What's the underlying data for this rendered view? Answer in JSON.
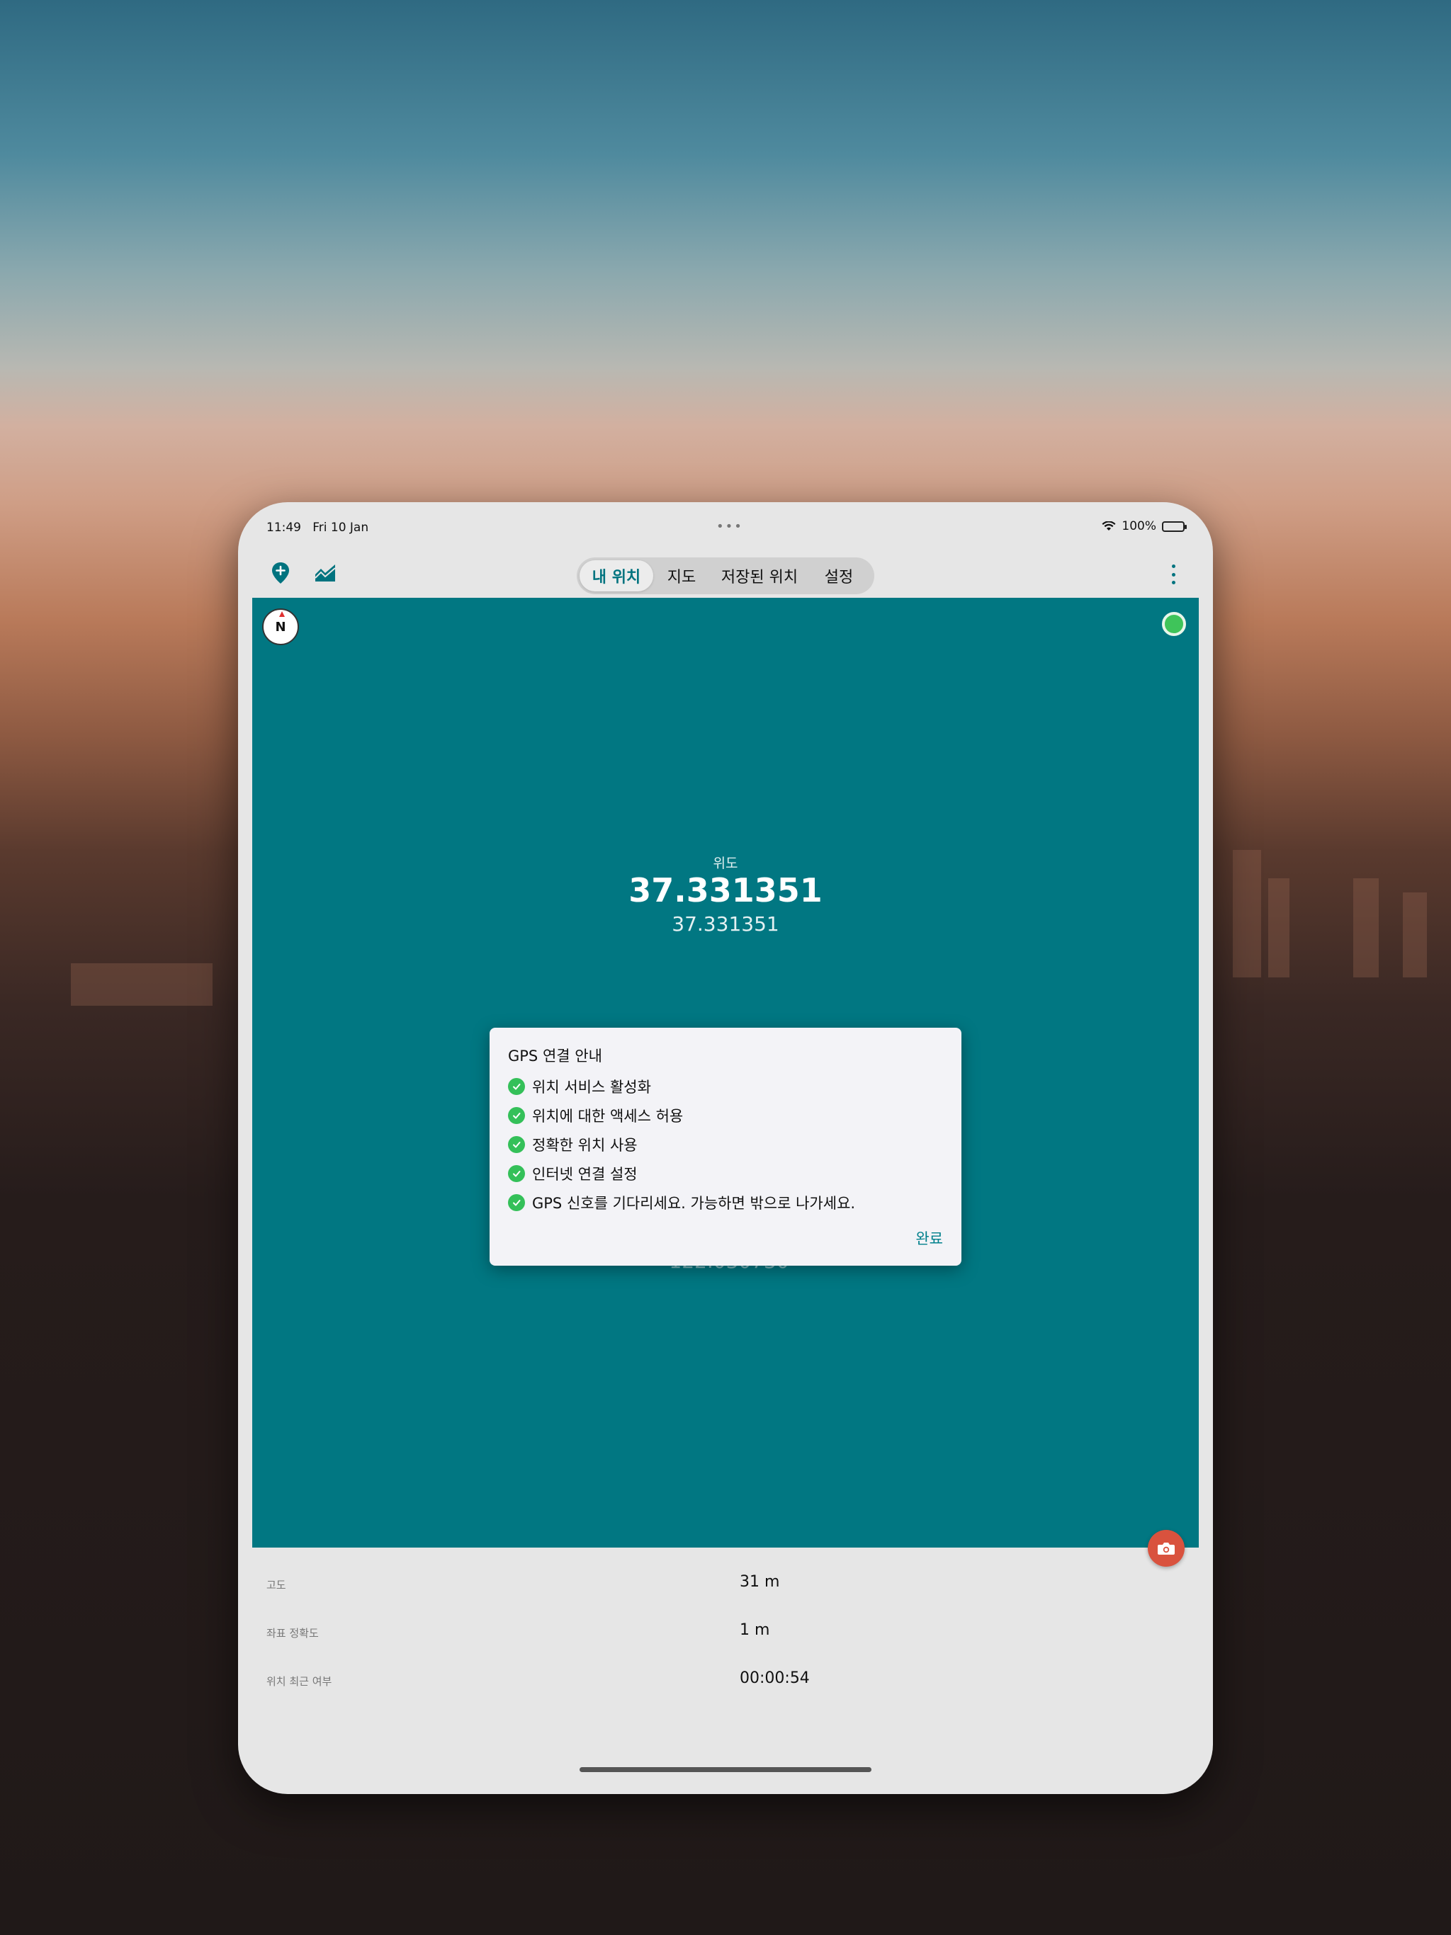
{
  "status_bar": {
    "time": "11:49",
    "date": "Fri 10 Jan",
    "dots": "•••",
    "battery": "100%"
  },
  "toolbar": {
    "add_location_icon": "map-pin-plus-icon",
    "elevation_icon": "chart-area-icon",
    "tabs": [
      {
        "label": "내 위치",
        "active": true
      },
      {
        "label": "지도",
        "active": false
      },
      {
        "label": "저장된 위치",
        "active": false
      },
      {
        "label": "설정",
        "active": false
      }
    ],
    "more_icon": "vertical-ellipsis-icon"
  },
  "location": {
    "compass_label": "N",
    "latitude_label": "위도",
    "latitude_main": "37.331351",
    "latitude_sub": "37.331351",
    "longitude_sub": "-122.030730"
  },
  "dialog": {
    "title": "GPS 연결 안내",
    "items": [
      "위치 서비스 활성화",
      "위치에 대한 액세스 허용",
      "정확한 위치 사용",
      "인터넷 연결 설정",
      "GPS 신호를 기다리세요. 가능하면 밖으로 나가세요."
    ],
    "done_label": "완료"
  },
  "info": [
    {
      "label": "고도",
      "value": "31 m"
    },
    {
      "label": "좌표 정확도",
      "value": "1 m"
    },
    {
      "label": "위치 최근 여부",
      "value": "00:00:54"
    }
  ],
  "colors": {
    "accent": "#00737f",
    "panel": "#017782",
    "gps_ok": "#3fc45a",
    "camera": "#d9523e"
  }
}
